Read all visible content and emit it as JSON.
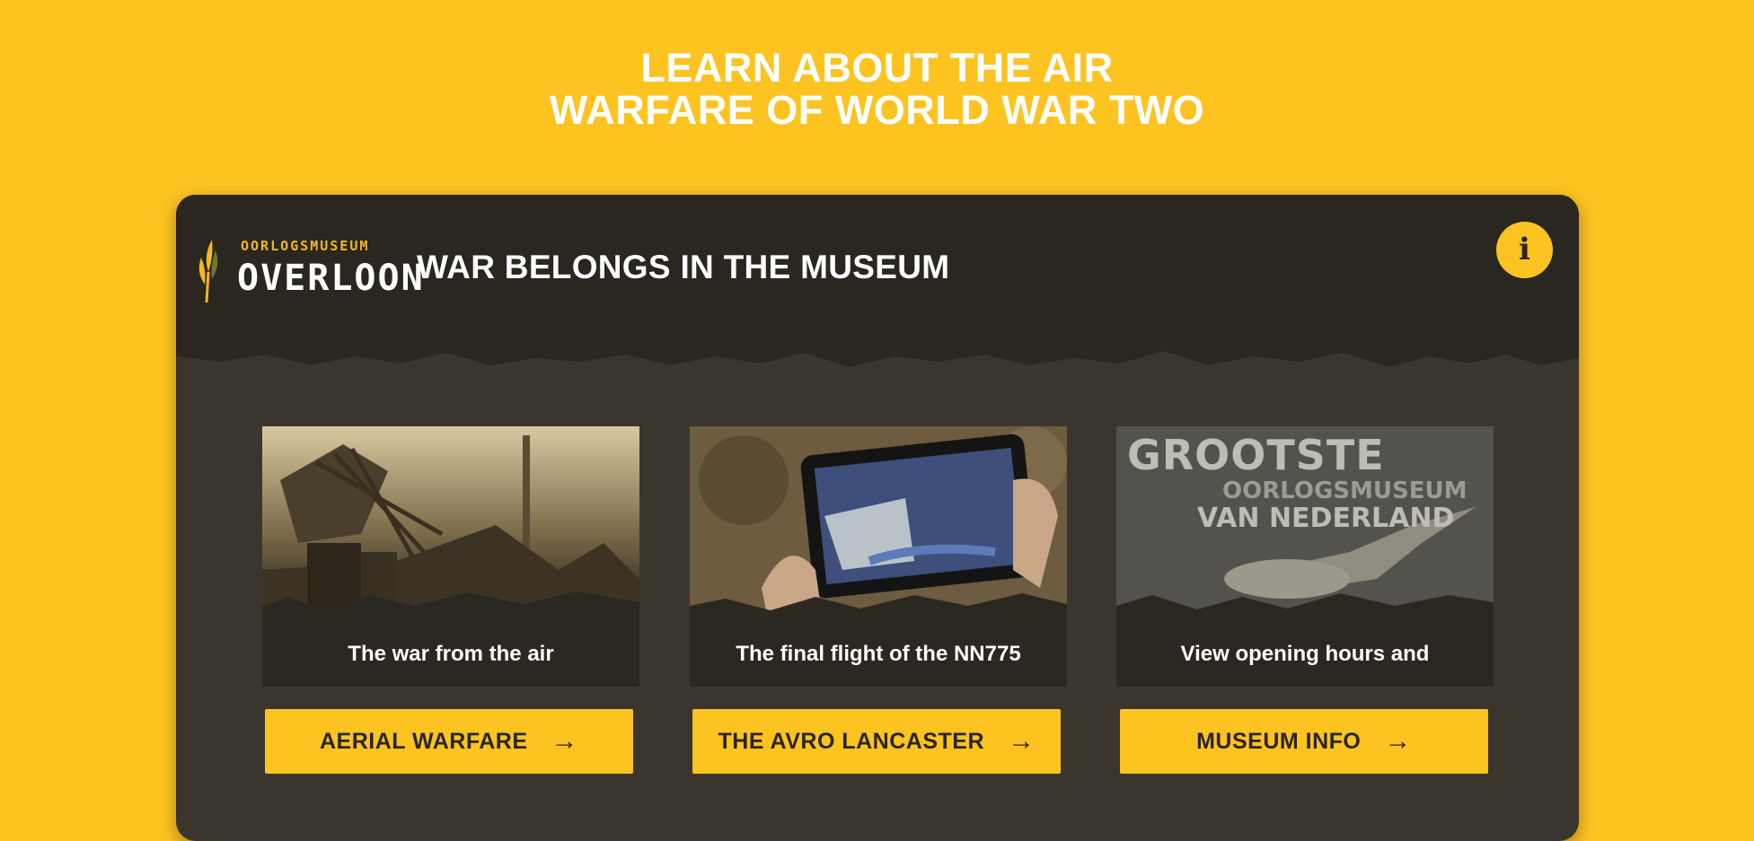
{
  "headline": {
    "line1": "LEARN ABOUT THE AIR",
    "line2": "WARFARE OF WORLD WAR TWO"
  },
  "header": {
    "logo_small": "OORLOGSMUSEUM",
    "logo_big": "OVERLOON",
    "tagline": "WAR BELONGS IN THE MUSEUM",
    "info_icon": "i"
  },
  "tiles": [
    {
      "caption": "The war from the air",
      "button": "AERIAL WARFARE",
      "arrow": "→"
    },
    {
      "caption": "The final flight of the NN775",
      "button": "THE AVRO LANCASTER",
      "arrow": "→"
    },
    {
      "caption": "View opening hours and",
      "button": "MUSEUM INFO",
      "arrow": "→",
      "poster_line1": "GROOTSTE",
      "poster_line2": "OORLOGSMUSEUM",
      "poster_line3": "VAN NEDERLAND"
    }
  ],
  "colors": {
    "accent": "#fdc321",
    "card": "#3b362d",
    "header": "#2a2620"
  },
  "icons": {
    "info": "info-icon",
    "arrow": "arrow-right-icon",
    "logo": "wheat-logo-icon"
  }
}
